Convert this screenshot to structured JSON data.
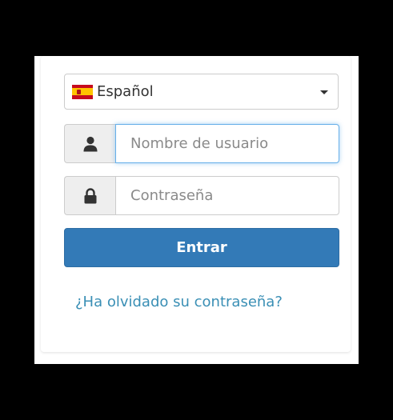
{
  "login": {
    "language": {
      "selected": "Español",
      "flag_icon": "spain-flag-icon"
    },
    "username": {
      "placeholder": "Nombre de usuario",
      "value": "",
      "icon": "user-icon"
    },
    "password": {
      "placeholder": "Contraseña",
      "value": "",
      "icon": "lock-icon"
    },
    "submit_label": "Entrar",
    "forgot_label": "¿Ha olvidado su contraseña?"
  },
  "colors": {
    "primary": "#337ab7",
    "link": "#3a8fb5",
    "focus_border": "#66afe9"
  }
}
